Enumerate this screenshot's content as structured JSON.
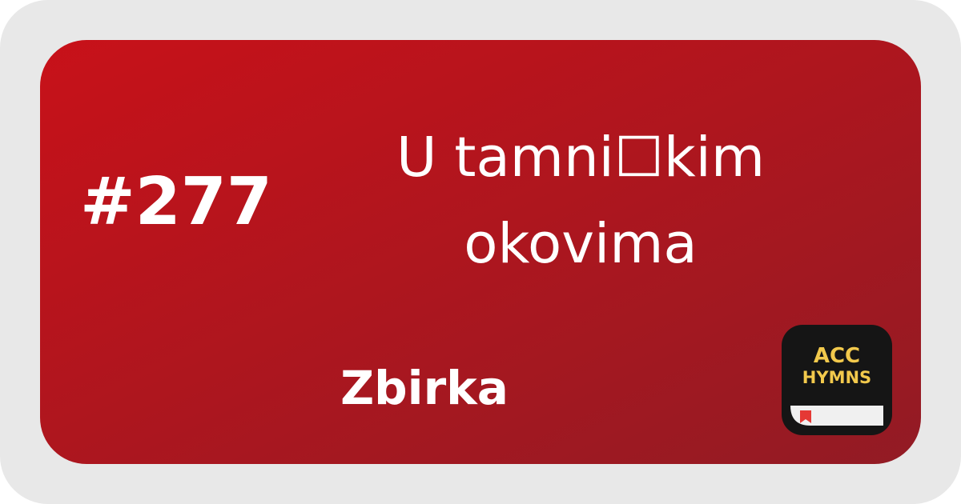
{
  "hymn": {
    "number": "#277",
    "title_line1": "U tamni☐kim",
    "title_line2": "okovima",
    "collection": "Zbirka"
  },
  "app_icon": {
    "line1": "ACC",
    "line2": "HYMNS",
    "icon": "hymnbook-app-icon",
    "text_color": "#f2c94c"
  },
  "colors": {
    "background": "#e8e8e8",
    "card_gradient_start": "#c81119",
    "card_gradient_end": "#921b24",
    "text": "#ffffff"
  }
}
